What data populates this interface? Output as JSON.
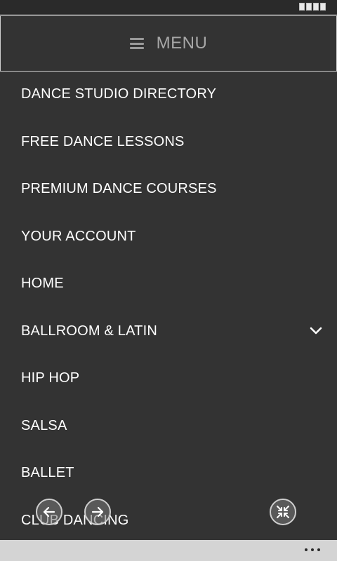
{
  "status_bar": {
    "battery_icon": "battery-icon"
  },
  "header": {
    "menu_icon": "hamburger-icon",
    "title": "MENU"
  },
  "menu": {
    "items": [
      {
        "label": "DANCE STUDIO DIRECTORY"
      },
      {
        "label": "FREE DANCE LESSONS"
      },
      {
        "label": "PREMIUM DANCE COURSES"
      },
      {
        "label": "YOUR ACCOUNT"
      },
      {
        "label": "HOME"
      },
      {
        "label": "BALLROOM & LATIN",
        "expand_icon": "chevron-down-icon"
      },
      {
        "label": "HIP HOP"
      },
      {
        "label": "SALSA"
      },
      {
        "label": "BALLET"
      },
      {
        "label": "CLUB DANCING"
      }
    ]
  },
  "browser_controls": {
    "back_icon": "arrow-left-icon",
    "forward_icon": "arrow-right-icon",
    "collapse_icon": "collapse-icon"
  },
  "app_bar": {
    "more_icon": "more-icon"
  },
  "colors": {
    "background": "#333333",
    "text": "#ffffff",
    "header_text": "#a7a7a7",
    "app_bar": "#d4d4d4"
  }
}
